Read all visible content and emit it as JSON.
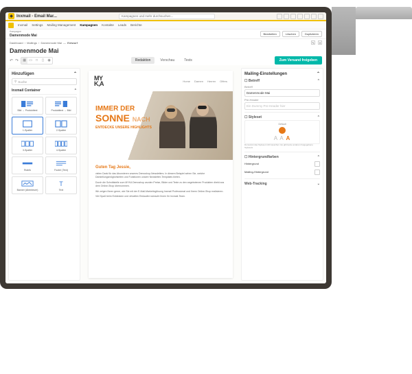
{
  "browser": {
    "tab_title": "Inxmail - Email Mar...",
    "search_placeholder": "Kampagnen und mehr durchsuchen..."
  },
  "nav": {
    "items": [
      "Inxmail",
      "Settings",
      "Mailing Management",
      "Kampagnen",
      "Kontakte",
      "Leads",
      "Berichte"
    ],
    "active": "Kampagnen"
  },
  "campaign": {
    "label": "Kampagne",
    "name": "Damenmode Mai",
    "buttons": {
      "edit": "Bearbeiten",
      "delete": "Löschen",
      "duplicate": "Duplizieren"
    }
  },
  "breadcrumb": {
    "items": [
      "Dashboard",
      "Mailings",
      "Damenmode Mai"
    ],
    "status": "Entwurf"
  },
  "page": {
    "title": "Damenmode Mai"
  },
  "tabs": {
    "redaktion": "Redaktion",
    "vorschau": "Vorschau",
    "tests": "Tests"
  },
  "primary_action": "Zum Versand freigeben",
  "left_panel": {
    "title": "Hinzufügen",
    "search_placeholder": "Suche",
    "section": "Inxmail Container",
    "components": [
      {
        "label": "Bild → Produkttext"
      },
      {
        "label": "Produkttext → Bild"
      },
      {
        "label": "1-Spalter"
      },
      {
        "label": "2-Spalter"
      },
      {
        "label": "3-Spalter"
      },
      {
        "label": "4-Spalter"
      },
      {
        "label": "Rubrik"
      },
      {
        "label": "Footer (Text)"
      },
      {
        "label": "Banner (Abenteuer)"
      },
      {
        "label": "Text"
      }
    ]
  },
  "email": {
    "logo": "MY\nK,A",
    "nav": [
      "Home",
      "Damen",
      "Herren",
      "Offers"
    ],
    "hero": {
      "line1": "IMMER DER",
      "line2": "SONNE",
      "suffix": "NACH",
      "line3": "ENTDECKE UNSERE HIGHLIGHTS"
    },
    "greeting": "Guten Tag Jessie,",
    "para1": "vielen Dank für das Abonnieren unseres Demoshop-Newsletters. In diesem Beispiel sehen Sie, welche Darstellungsmöglichkeiten und Funktionen unsere Newsletter-Templates bieten.",
    "para2": "Durch die Schnittstelle zum MYKA Demoshop wurden Preise, Bilder und Texte zu den angebotenen Produkten direkt aus dem Online-Shop übernommen.",
    "para3": "Wir zeigen Ihnen gerne, wie Sie mit der E-Mail-Marketinglösung Inxmail Professional und Ihrem Online-Shop realisieren.",
    "para4": "Viel Spaß beim Entdecken und virtuellen Einkaufen wünscht Ihnen Ihr Inxmail-Team."
  },
  "right_panel": {
    "title": "Mailing-Einstellungen",
    "betreff": {
      "section": "Betreff",
      "label": "Betreff",
      "value": "Damenmode Mai",
      "preheader_label": "Pre-Header",
      "preheader_placeholder": "Ein Dummy Pre-Header hier"
    },
    "styleset": {
      "section": "Styleset",
      "name": "Default",
      "note": "Du kannst das Styleset nicht tauschen. Es gibt keine anderen freigegebene Stylesets"
    },
    "bg": {
      "section": "Hintergrundfarben",
      "hintergrund": "Hintergrund",
      "mailing": "Mailing-Hintergrund"
    },
    "tracking": "Web-Tracking"
  }
}
